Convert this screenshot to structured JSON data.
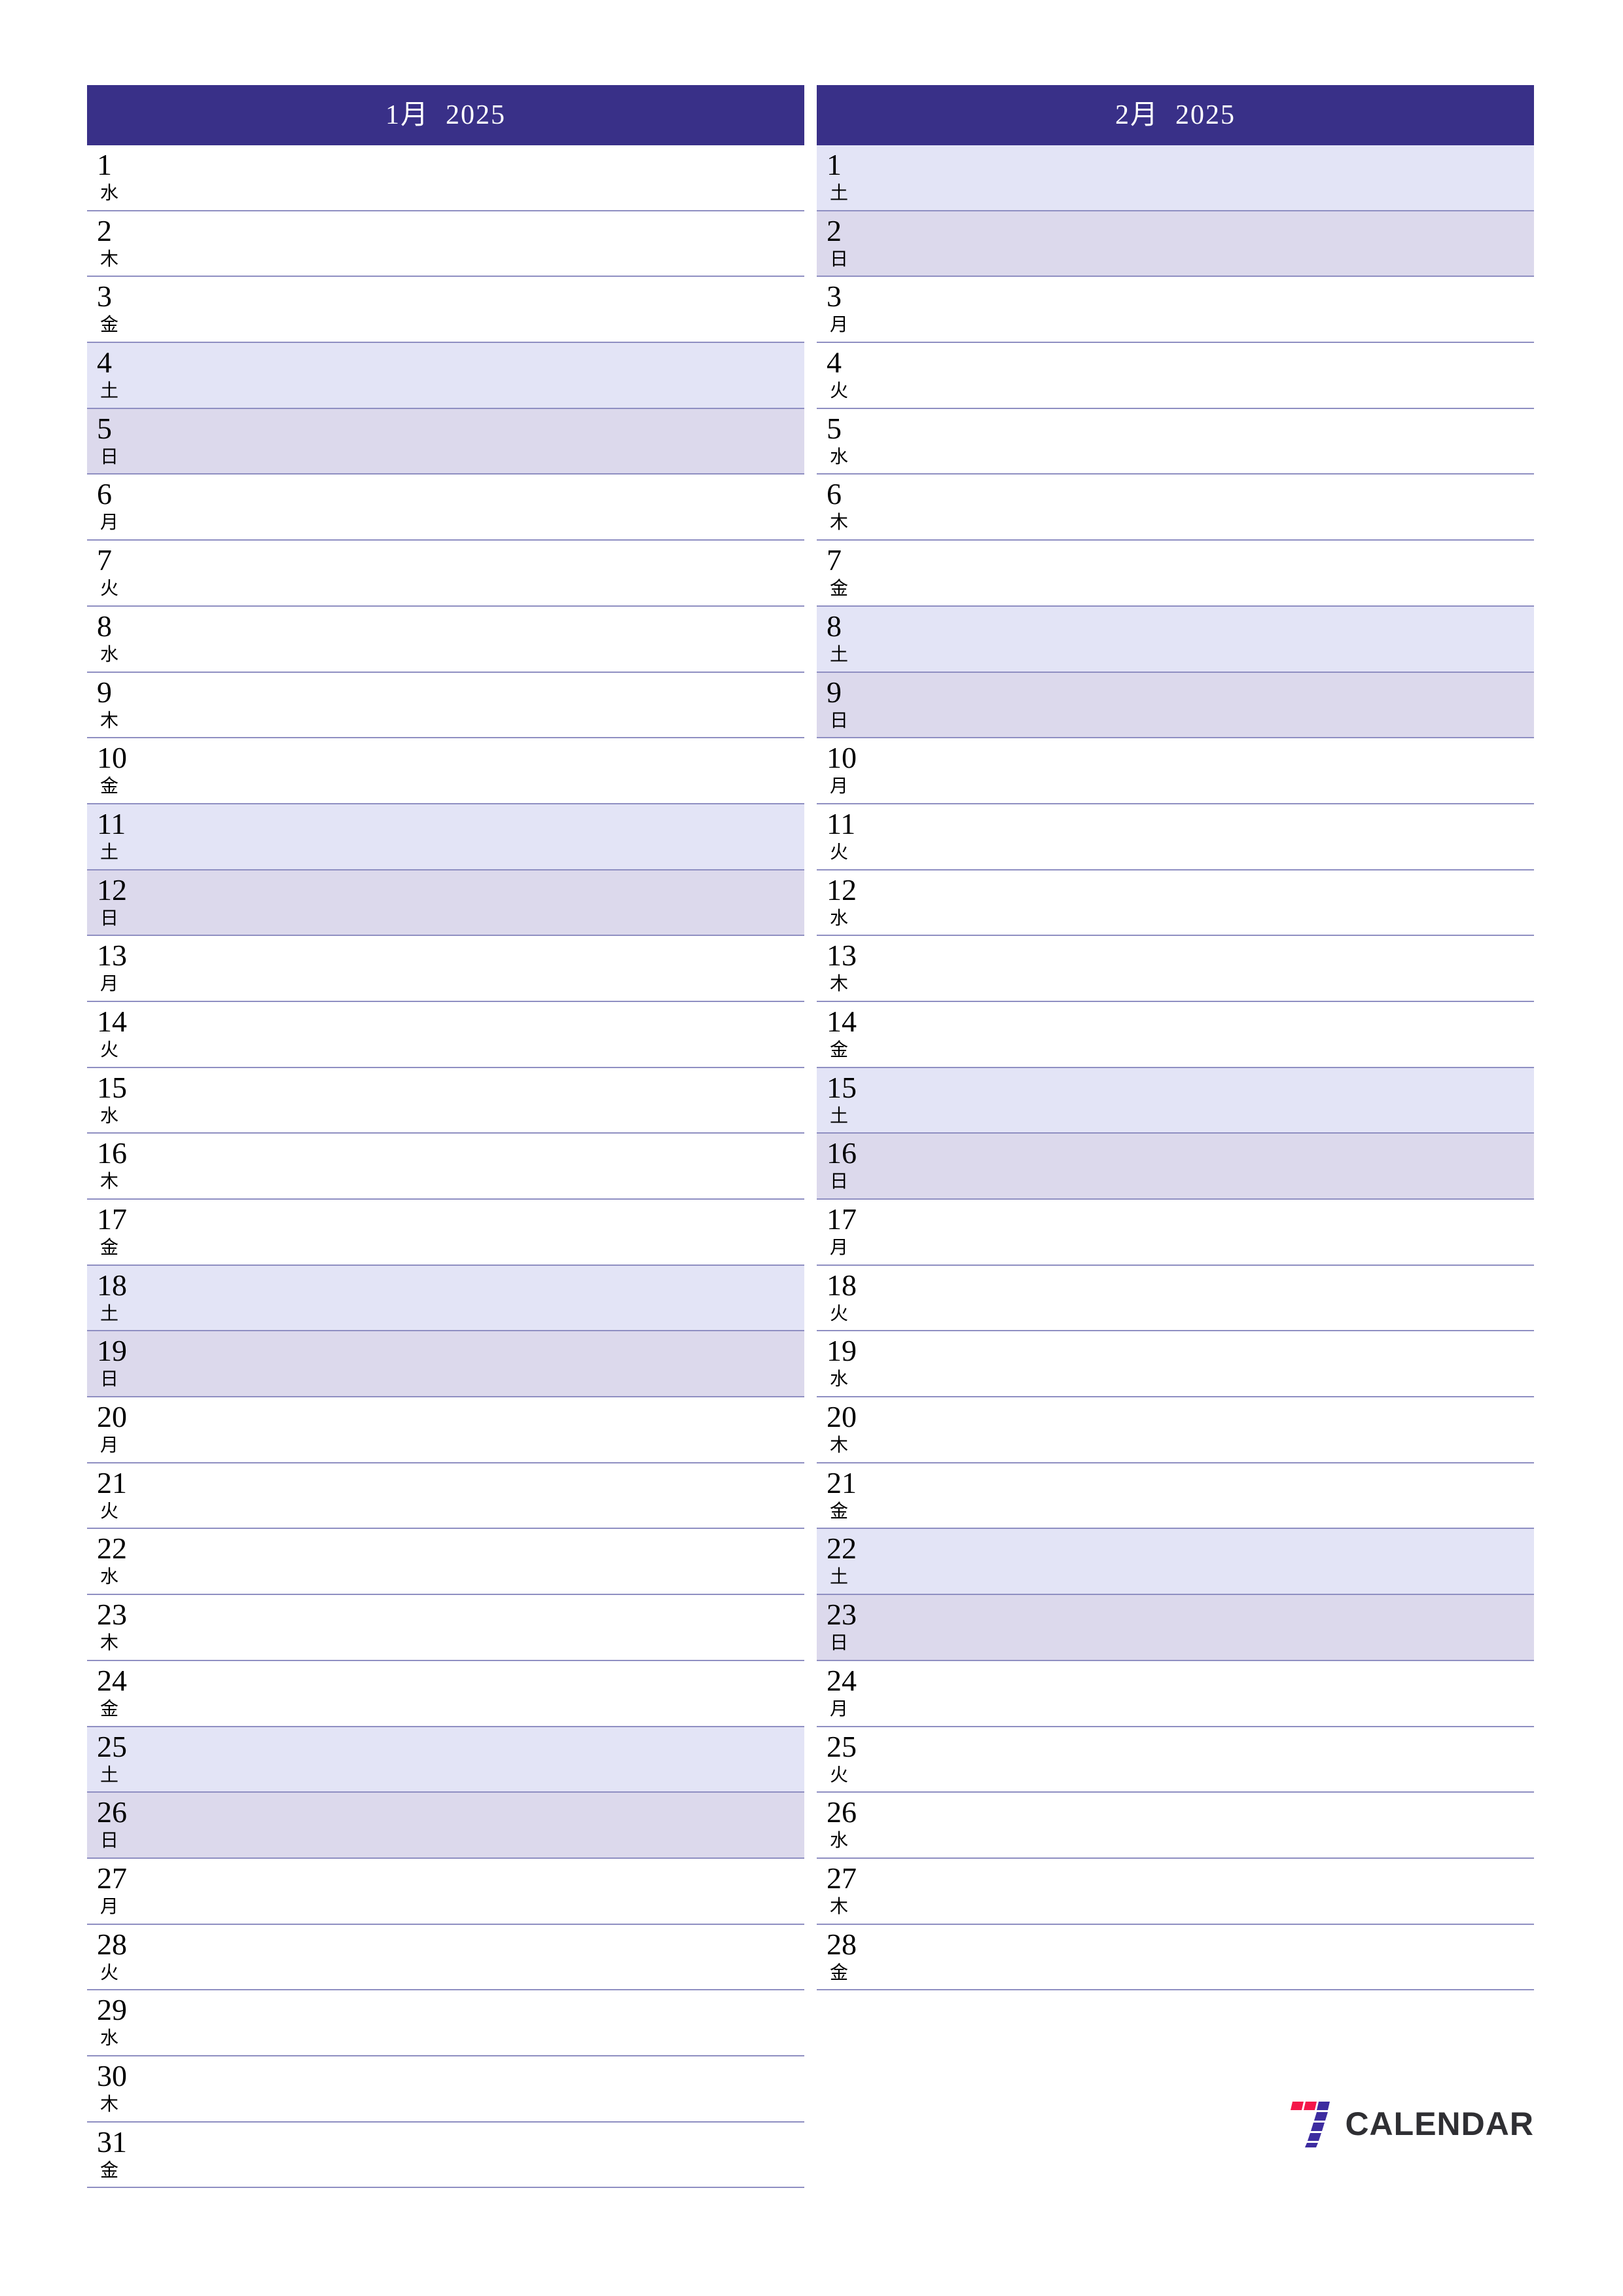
{
  "theme": {
    "header_bg": "#393088",
    "header_text": "#ffffff",
    "row_divider": "#8f8fc2",
    "saturday_bg": "#e3e4f6",
    "sunday_bg": "#dcd9ec",
    "day_text": "#000000",
    "brand_text_color": "#2f2f33",
    "brand_red": "#f4174a",
    "brand_purple": "#3d2ca0"
  },
  "brand": {
    "name": "CALENDAR",
    "mark_icon": "seven-logo-icon"
  },
  "months": [
    {
      "title": "1月  2025",
      "month_label": "1月",
      "year": "2025",
      "days": [
        {
          "num": "1",
          "weekday": "水",
          "type": "weekday"
        },
        {
          "num": "2",
          "weekday": "木",
          "type": "weekday"
        },
        {
          "num": "3",
          "weekday": "金",
          "type": "weekday"
        },
        {
          "num": "4",
          "weekday": "土",
          "type": "sat"
        },
        {
          "num": "5",
          "weekday": "日",
          "type": "sun"
        },
        {
          "num": "6",
          "weekday": "月",
          "type": "weekday"
        },
        {
          "num": "7",
          "weekday": "火",
          "type": "weekday"
        },
        {
          "num": "8",
          "weekday": "水",
          "type": "weekday"
        },
        {
          "num": "9",
          "weekday": "木",
          "type": "weekday"
        },
        {
          "num": "10",
          "weekday": "金",
          "type": "weekday"
        },
        {
          "num": "11",
          "weekday": "土",
          "type": "sat"
        },
        {
          "num": "12",
          "weekday": "日",
          "type": "sun"
        },
        {
          "num": "13",
          "weekday": "月",
          "type": "weekday"
        },
        {
          "num": "14",
          "weekday": "火",
          "type": "weekday"
        },
        {
          "num": "15",
          "weekday": "水",
          "type": "weekday"
        },
        {
          "num": "16",
          "weekday": "木",
          "type": "weekday"
        },
        {
          "num": "17",
          "weekday": "金",
          "type": "weekday"
        },
        {
          "num": "18",
          "weekday": "土",
          "type": "sat"
        },
        {
          "num": "19",
          "weekday": "日",
          "type": "sun"
        },
        {
          "num": "20",
          "weekday": "月",
          "type": "weekday"
        },
        {
          "num": "21",
          "weekday": "火",
          "type": "weekday"
        },
        {
          "num": "22",
          "weekday": "水",
          "type": "weekday"
        },
        {
          "num": "23",
          "weekday": "木",
          "type": "weekday"
        },
        {
          "num": "24",
          "weekday": "金",
          "type": "weekday"
        },
        {
          "num": "25",
          "weekday": "土",
          "type": "sat"
        },
        {
          "num": "26",
          "weekday": "日",
          "type": "sun"
        },
        {
          "num": "27",
          "weekday": "月",
          "type": "weekday"
        },
        {
          "num": "28",
          "weekday": "火",
          "type": "weekday"
        },
        {
          "num": "29",
          "weekday": "水",
          "type": "weekday"
        },
        {
          "num": "30",
          "weekday": "木",
          "type": "weekday"
        },
        {
          "num": "31",
          "weekday": "金",
          "type": "weekday"
        }
      ]
    },
    {
      "title": "2月  2025",
      "month_label": "2月",
      "year": "2025",
      "days": [
        {
          "num": "1",
          "weekday": "土",
          "type": "sat"
        },
        {
          "num": "2",
          "weekday": "日",
          "type": "sun"
        },
        {
          "num": "3",
          "weekday": "月",
          "type": "weekday"
        },
        {
          "num": "4",
          "weekday": "火",
          "type": "weekday"
        },
        {
          "num": "5",
          "weekday": "水",
          "type": "weekday"
        },
        {
          "num": "6",
          "weekday": "木",
          "type": "weekday"
        },
        {
          "num": "7",
          "weekday": "金",
          "type": "weekday"
        },
        {
          "num": "8",
          "weekday": "土",
          "type": "sat"
        },
        {
          "num": "9",
          "weekday": "日",
          "type": "sun"
        },
        {
          "num": "10",
          "weekday": "月",
          "type": "weekday"
        },
        {
          "num": "11",
          "weekday": "火",
          "type": "weekday"
        },
        {
          "num": "12",
          "weekday": "水",
          "type": "weekday"
        },
        {
          "num": "13",
          "weekday": "木",
          "type": "weekday"
        },
        {
          "num": "14",
          "weekday": "金",
          "type": "weekday"
        },
        {
          "num": "15",
          "weekday": "土",
          "type": "sat"
        },
        {
          "num": "16",
          "weekday": "日",
          "type": "sun"
        },
        {
          "num": "17",
          "weekday": "月",
          "type": "weekday"
        },
        {
          "num": "18",
          "weekday": "火",
          "type": "weekday"
        },
        {
          "num": "19",
          "weekday": "水",
          "type": "weekday"
        },
        {
          "num": "20",
          "weekday": "木",
          "type": "weekday"
        },
        {
          "num": "21",
          "weekday": "金",
          "type": "weekday"
        },
        {
          "num": "22",
          "weekday": "土",
          "type": "sat"
        },
        {
          "num": "23",
          "weekday": "日",
          "type": "sun"
        },
        {
          "num": "24",
          "weekday": "月",
          "type": "weekday"
        },
        {
          "num": "25",
          "weekday": "火",
          "type": "weekday"
        },
        {
          "num": "26",
          "weekday": "水",
          "type": "weekday"
        },
        {
          "num": "27",
          "weekday": "木",
          "type": "weekday"
        },
        {
          "num": "28",
          "weekday": "金",
          "type": "weekday"
        }
      ]
    }
  ]
}
